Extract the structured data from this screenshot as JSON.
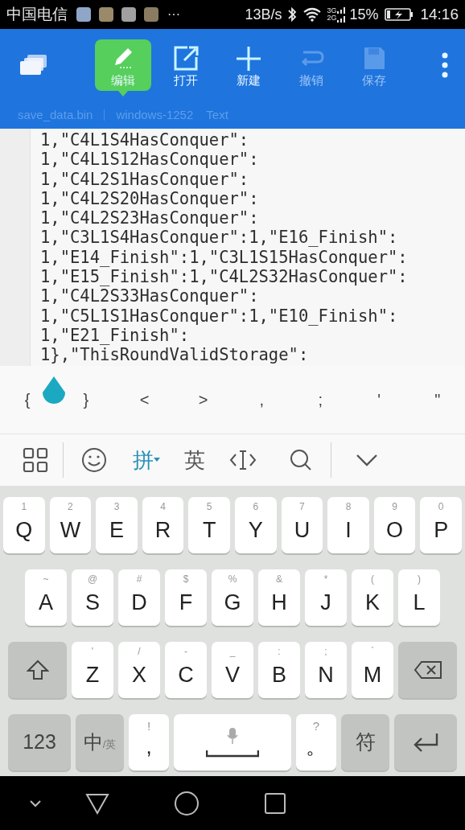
{
  "status_bar": {
    "carrier": "中国电信",
    "more": "···",
    "speed": "13B/s",
    "network": [
      "3G",
      "2G"
    ],
    "battery": "15%",
    "time": "14:16"
  },
  "toolbar": {
    "buttons": [
      {
        "label": "编辑",
        "selected": true,
        "disabled": false
      },
      {
        "label": "打开",
        "selected": false,
        "disabled": false
      },
      {
        "label": "新建",
        "selected": false,
        "disabled": false
      },
      {
        "label": "撤销",
        "selected": false,
        "disabled": true
      },
      {
        "label": "保存",
        "selected": false,
        "disabled": true
      }
    ]
  },
  "path_bar": {
    "file": "save_data.bin",
    "encoding": "windows-1252",
    "mode": "Text"
  },
  "editor": {
    "lines": [
      "1,\"C4L1S4HasConquer\":",
      "1,\"C4L1S12HasConquer\":",
      "1,\"C4L2S1HasConquer\":",
      "1,\"C4L2S20HasConquer\":",
      "1,\"C4L2S23HasConquer\":",
      "1,\"C3L1S4HasConquer\":1,\"E16_Finish\":",
      "1,\"E14_Finish\":1,\"C3L1S15HasConquer\":",
      "1,\"E15_Finish\":1,\"C4L2S32HasConquer\":",
      "1,\"C4L2S33HasConquer\":",
      "1,\"C5L1S1HasConquer\":1,\"E10_Finish\":",
      "1,\"E21_Finish\":",
      "1},\"ThisRoundValidStorage\":"
    ]
  },
  "symbol_bar": {
    "keys": [
      "{",
      "}",
      "<",
      ">",
      ",",
      ";",
      "'",
      "\""
    ]
  },
  "ime_toolbar": {
    "modes": [
      {
        "label": "拼",
        "selected": true
      },
      {
        "label": "英",
        "selected": false
      }
    ]
  },
  "keyboard": {
    "row_1": [
      {
        "kind": "letter",
        "label": "Q",
        "hint": "1"
      },
      {
        "kind": "letter",
        "label": "W",
        "hint": "2"
      },
      {
        "kind": "letter",
        "label": "E",
        "hint": "3"
      },
      {
        "kind": "letter",
        "label": "R",
        "hint": "4"
      },
      {
        "kind": "letter",
        "label": "T",
        "hint": "5"
      },
      {
        "kind": "letter",
        "label": "Y",
        "hint": "6"
      },
      {
        "kind": "letter",
        "label": "U",
        "hint": "7"
      },
      {
        "kind": "letter",
        "label": "I",
        "hint": "8"
      },
      {
        "kind": "letter",
        "label": "O",
        "hint": "9"
      },
      {
        "kind": "letter",
        "label": "P",
        "hint": "0"
      }
    ],
    "row_2": [
      {
        "kind": "letter",
        "label": "A",
        "hint": "~"
      },
      {
        "kind": "letter",
        "label": "S",
        "hint": "@"
      },
      {
        "kind": "letter",
        "label": "D",
        "hint": "#"
      },
      {
        "kind": "letter",
        "label": "F",
        "hint": "$"
      },
      {
        "kind": "letter",
        "label": "G",
        "hint": "%"
      },
      {
        "kind": "letter",
        "label": "H",
        "hint": "&"
      },
      {
        "kind": "letter",
        "label": "J",
        "hint": "*"
      },
      {
        "kind": "letter",
        "label": "K",
        "hint": "("
      },
      {
        "kind": "letter",
        "label": "L",
        "hint": ")"
      }
    ],
    "row_3": [
      {
        "kind": "shift"
      },
      {
        "kind": "letter",
        "label": "Z",
        "hint": "'"
      },
      {
        "kind": "letter",
        "label": "X",
        "hint": "/"
      },
      {
        "kind": "letter",
        "label": "C",
        "hint": "-"
      },
      {
        "kind": "letter",
        "label": "V",
        "hint": "_"
      },
      {
        "kind": "letter",
        "label": "B",
        "hint": ":"
      },
      {
        "kind": "letter",
        "label": "N",
        "hint": ";"
      },
      {
        "kind": "letter",
        "label": "M",
        "hint": "`"
      },
      {
        "kind": "backspace"
      }
    ],
    "bottom_row": [
      {
        "kind": "function",
        "label": "123"
      },
      {
        "kind": "lang",
        "label": "中",
        "sub": "/英"
      },
      {
        "kind": "punct",
        "label": ",",
        "hint": "!"
      },
      {
        "kind": "space"
      },
      {
        "kind": "punct",
        "label": "。",
        "hint": "?"
      },
      {
        "kind": "function",
        "label": "符"
      },
      {
        "kind": "enter"
      }
    ]
  }
}
